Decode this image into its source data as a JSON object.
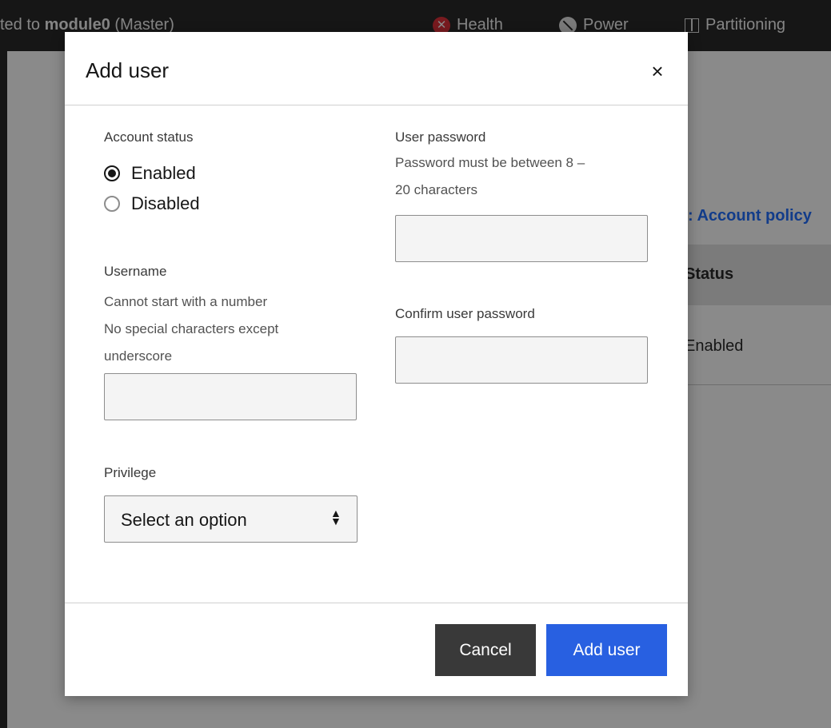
{
  "topbar": {
    "connected_prefix": "ted to ",
    "connected_host": "module0",
    "connected_suffix": " (Master)",
    "nav": {
      "health": "Health",
      "power": "Power",
      "partitioning": "Partitioning"
    }
  },
  "background": {
    "account_policy_link": ": Account policy",
    "table": {
      "header_status": "Status",
      "row_status": "Enabled"
    }
  },
  "modal": {
    "title": "Add user",
    "close_symbol": "×",
    "account_status": {
      "label": "Account status",
      "options": [
        "Enabled",
        "Disabled"
      ],
      "selected": "Enabled"
    },
    "username": {
      "label": "Username",
      "help": [
        "Cannot start with a number",
        "No special characters except",
        "underscore"
      ],
      "value": ""
    },
    "privilege": {
      "label": "Privilege",
      "selected": "Select an option"
    },
    "user_password": {
      "label": "User password",
      "help": [
        "Password must be between 8 –",
        "20 characters"
      ],
      "value": ""
    },
    "confirm_password": {
      "label": "Confirm user password",
      "value": ""
    },
    "footer": {
      "cancel": "Cancel",
      "submit": "Add user"
    }
  },
  "icons": {
    "health": "error-circle-icon",
    "power": "power-off-icon",
    "partitioning": "partition-icon",
    "password_visibility": "eye-icon"
  },
  "colors": {
    "primary": "#2860e1",
    "link": "#0f62fe",
    "danger": "#da1e28",
    "topbar": "#161616"
  }
}
